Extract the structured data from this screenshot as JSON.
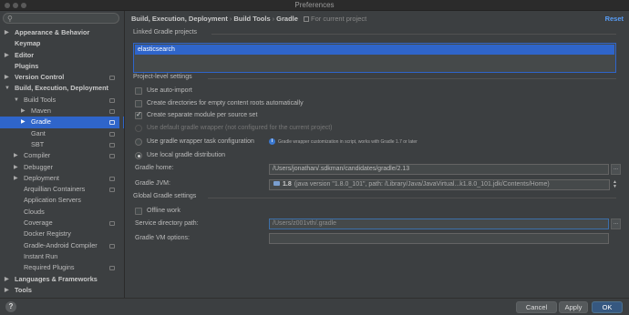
{
  "window": {
    "title": "Preferences"
  },
  "search": {
    "value": "",
    "placeholder": ""
  },
  "sidebar": {
    "items": [
      {
        "label": "Appearance & Behavior",
        "bold": true,
        "arrow": "▶",
        "indent": 0
      },
      {
        "label": "Keymap",
        "bold": true,
        "arrow": "",
        "indent": 0
      },
      {
        "label": "Editor",
        "bold": true,
        "arrow": "▶",
        "indent": 0
      },
      {
        "label": "Plugins",
        "bold": true,
        "arrow": "",
        "indent": 0
      },
      {
        "label": "Version Control",
        "bold": true,
        "arrow": "▶",
        "indent": 0,
        "copy": true
      },
      {
        "label": "Build, Execution, Deployment",
        "bold": true,
        "arrow": "▼",
        "indent": 0
      },
      {
        "label": "Build Tools",
        "bold": false,
        "arrow": "▼",
        "indent": 1,
        "copy": true
      },
      {
        "label": "Maven",
        "bold": false,
        "arrow": "▶",
        "indent": 2,
        "copy": true
      },
      {
        "label": "Gradle",
        "bold": false,
        "arrow": "▶",
        "indent": 2,
        "copy": true,
        "selected": true
      },
      {
        "label": "Gant",
        "bold": false,
        "arrow": "",
        "indent": 2,
        "copy": true
      },
      {
        "label": "SBT",
        "bold": false,
        "arrow": "",
        "indent": 2,
        "copy": true
      },
      {
        "label": "Compiler",
        "bold": false,
        "arrow": "▶",
        "indent": 1,
        "copy": true
      },
      {
        "label": "Debugger",
        "bold": false,
        "arrow": "▶",
        "indent": 1
      },
      {
        "label": "Deployment",
        "bold": false,
        "arrow": "▶",
        "indent": 1,
        "copy": true
      },
      {
        "label": "Arquillian Containers",
        "bold": false,
        "arrow": "",
        "indent": 1,
        "copy": true
      },
      {
        "label": "Application Servers",
        "bold": false,
        "arrow": "",
        "indent": 1
      },
      {
        "label": "Clouds",
        "bold": false,
        "arrow": "",
        "indent": 1
      },
      {
        "label": "Coverage",
        "bold": false,
        "arrow": "",
        "indent": 1,
        "copy": true
      },
      {
        "label": "Docker Registry",
        "bold": false,
        "arrow": "",
        "indent": 1
      },
      {
        "label": "Gradle-Android Compiler",
        "bold": false,
        "arrow": "",
        "indent": 1,
        "copy": true
      },
      {
        "label": "Instant Run",
        "bold": false,
        "arrow": "",
        "indent": 1
      },
      {
        "label": "Required Plugins",
        "bold": false,
        "arrow": "",
        "indent": 1,
        "copy": true
      },
      {
        "label": "Languages & Frameworks",
        "bold": true,
        "arrow": "▶",
        "indent": 0
      },
      {
        "label": "Tools",
        "bold": true,
        "arrow": "▶",
        "indent": 0
      }
    ]
  },
  "header": {
    "crumb1": "Build, Execution, Deployment",
    "sep": "›",
    "crumb2": "Build Tools",
    "crumb3": "Gradle",
    "scope": "For current project",
    "reset": "Reset"
  },
  "linked": {
    "title": "Linked Gradle projects",
    "items": [
      "elasticsearch"
    ]
  },
  "project_settings": {
    "title": "Project-level settings",
    "auto_import": {
      "label": "Use auto-import",
      "checked": false
    },
    "create_dirs": {
      "label": "Create directories for empty content roots automatically",
      "checked": false
    },
    "separate_module": {
      "label": "Create separate module per source set",
      "checked": true
    },
    "default_wrapper": {
      "label": "Use default gradle wrapper (not configured for the current project)",
      "checked": false
    },
    "wrapper_task": {
      "label": "Use gradle wrapper task configuration",
      "checked": false
    },
    "wrapper_hint": "Gradle wrapper customization in script, works with Gradle 1.7 or later",
    "local_dist": {
      "label": "Use local gradle distribution",
      "checked": true
    },
    "gradle_home_label": "Gradle home:",
    "gradle_home_value": "/Users/jonathan/.sdkman/candidates/gradle/2.13",
    "gradle_jvm_label": "Gradle JVM:",
    "gradle_jvm_version": "1.8",
    "gradle_jvm_detail": "(java version \"1.8.0_101\", path: /Library/Java/JavaVirtual...k1.8.0_101.jdk/Contents/Home)",
    "browse": "..."
  },
  "global_settings": {
    "title": "Global Gradle settings",
    "offline": {
      "label": "Offline work",
      "checked": false
    },
    "service_dir_label": "Service directory path:",
    "service_dir_value": "/Users/z001vth/.gradle",
    "vm_options_label": "Gradle VM options:",
    "vm_options_value": ""
  },
  "footer": {
    "help": "?",
    "cancel": "Cancel",
    "apply": "Apply",
    "ok": "OK"
  },
  "colors": {
    "accent": "#2f65ca",
    "link": "#589df6",
    "background": "#3c3f41"
  }
}
